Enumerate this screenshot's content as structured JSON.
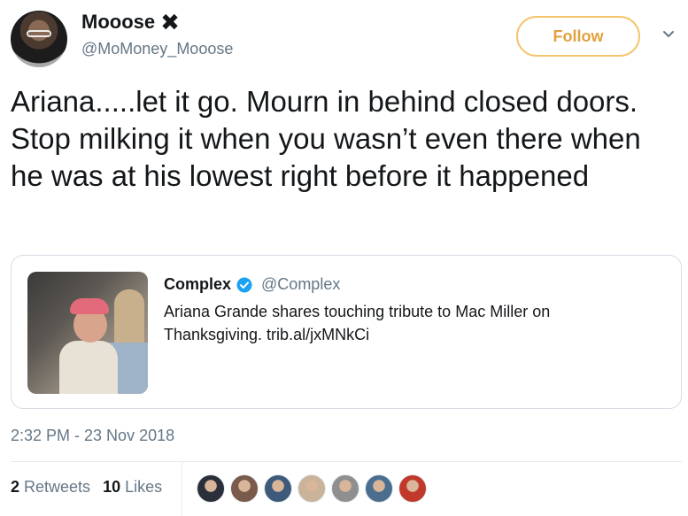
{
  "tweet": {
    "author": {
      "display_name": "Mooose",
      "name_emoji": "✖",
      "handle": "@MoMoney_Mooose"
    },
    "follow_label": "Follow",
    "text": "Ariana.....let it go. Mourn in behind closed doors. Stop milking it when you wasn’t even there when he was at his lowest right before it happened",
    "quoted": {
      "display_name": "Complex",
      "handle": "@Complex",
      "text": "Ariana Grande shares touching tribute to Mac Miller on Thanksgiving. trib.al/jxMNkCi"
    },
    "timestamp": "2:32 PM - 23 Nov 2018",
    "stats": {
      "retweets_count": "2",
      "retweets_label": "Retweets",
      "likes_count": "10",
      "likes_label": "Likes"
    },
    "liker_colors": [
      "#2b2f3a",
      "#7a5a4a",
      "#3d5a7a",
      "#c9b39a",
      "#8f8f8f",
      "#4b6e8f",
      "#c0392b"
    ]
  },
  "colors": {
    "follow_border": "#f5c46b",
    "follow_text": "#e2a13c",
    "verified_blue": "#1da1f2",
    "secondary_text": "#657786"
  }
}
